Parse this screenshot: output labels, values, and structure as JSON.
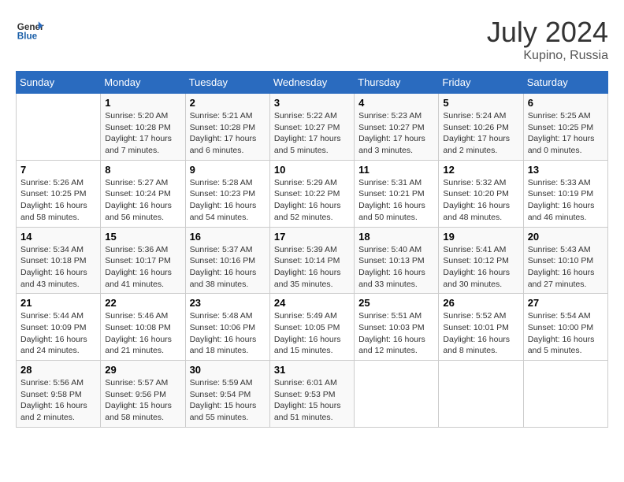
{
  "header": {
    "logo_line1": "General",
    "logo_line2": "Blue",
    "month_year": "July 2024",
    "location": "Kupino, Russia"
  },
  "weekdays": [
    "Sunday",
    "Monday",
    "Tuesday",
    "Wednesday",
    "Thursday",
    "Friday",
    "Saturday"
  ],
  "weeks": [
    [
      {
        "day": "",
        "info": ""
      },
      {
        "day": "1",
        "info": "Sunrise: 5:20 AM\nSunset: 10:28 PM\nDaylight: 17 hours\nand 7 minutes."
      },
      {
        "day": "2",
        "info": "Sunrise: 5:21 AM\nSunset: 10:28 PM\nDaylight: 17 hours\nand 6 minutes."
      },
      {
        "day": "3",
        "info": "Sunrise: 5:22 AM\nSunset: 10:27 PM\nDaylight: 17 hours\nand 5 minutes."
      },
      {
        "day": "4",
        "info": "Sunrise: 5:23 AM\nSunset: 10:27 PM\nDaylight: 17 hours\nand 3 minutes."
      },
      {
        "day": "5",
        "info": "Sunrise: 5:24 AM\nSunset: 10:26 PM\nDaylight: 17 hours\nand 2 minutes."
      },
      {
        "day": "6",
        "info": "Sunrise: 5:25 AM\nSunset: 10:25 PM\nDaylight: 17 hours\nand 0 minutes."
      }
    ],
    [
      {
        "day": "7",
        "info": "Sunrise: 5:26 AM\nSunset: 10:25 PM\nDaylight: 16 hours\nand 58 minutes."
      },
      {
        "day": "8",
        "info": "Sunrise: 5:27 AM\nSunset: 10:24 PM\nDaylight: 16 hours\nand 56 minutes."
      },
      {
        "day": "9",
        "info": "Sunrise: 5:28 AM\nSunset: 10:23 PM\nDaylight: 16 hours\nand 54 minutes."
      },
      {
        "day": "10",
        "info": "Sunrise: 5:29 AM\nSunset: 10:22 PM\nDaylight: 16 hours\nand 52 minutes."
      },
      {
        "day": "11",
        "info": "Sunrise: 5:31 AM\nSunset: 10:21 PM\nDaylight: 16 hours\nand 50 minutes."
      },
      {
        "day": "12",
        "info": "Sunrise: 5:32 AM\nSunset: 10:20 PM\nDaylight: 16 hours\nand 48 minutes."
      },
      {
        "day": "13",
        "info": "Sunrise: 5:33 AM\nSunset: 10:19 PM\nDaylight: 16 hours\nand 46 minutes."
      }
    ],
    [
      {
        "day": "14",
        "info": "Sunrise: 5:34 AM\nSunset: 10:18 PM\nDaylight: 16 hours\nand 43 minutes."
      },
      {
        "day": "15",
        "info": "Sunrise: 5:36 AM\nSunset: 10:17 PM\nDaylight: 16 hours\nand 41 minutes."
      },
      {
        "day": "16",
        "info": "Sunrise: 5:37 AM\nSunset: 10:16 PM\nDaylight: 16 hours\nand 38 minutes."
      },
      {
        "day": "17",
        "info": "Sunrise: 5:39 AM\nSunset: 10:14 PM\nDaylight: 16 hours\nand 35 minutes."
      },
      {
        "day": "18",
        "info": "Sunrise: 5:40 AM\nSunset: 10:13 PM\nDaylight: 16 hours\nand 33 minutes."
      },
      {
        "day": "19",
        "info": "Sunrise: 5:41 AM\nSunset: 10:12 PM\nDaylight: 16 hours\nand 30 minutes."
      },
      {
        "day": "20",
        "info": "Sunrise: 5:43 AM\nSunset: 10:10 PM\nDaylight: 16 hours\nand 27 minutes."
      }
    ],
    [
      {
        "day": "21",
        "info": "Sunrise: 5:44 AM\nSunset: 10:09 PM\nDaylight: 16 hours\nand 24 minutes."
      },
      {
        "day": "22",
        "info": "Sunrise: 5:46 AM\nSunset: 10:08 PM\nDaylight: 16 hours\nand 21 minutes."
      },
      {
        "day": "23",
        "info": "Sunrise: 5:48 AM\nSunset: 10:06 PM\nDaylight: 16 hours\nand 18 minutes."
      },
      {
        "day": "24",
        "info": "Sunrise: 5:49 AM\nSunset: 10:05 PM\nDaylight: 16 hours\nand 15 minutes."
      },
      {
        "day": "25",
        "info": "Sunrise: 5:51 AM\nSunset: 10:03 PM\nDaylight: 16 hours\nand 12 minutes."
      },
      {
        "day": "26",
        "info": "Sunrise: 5:52 AM\nSunset: 10:01 PM\nDaylight: 16 hours\nand 8 minutes."
      },
      {
        "day": "27",
        "info": "Sunrise: 5:54 AM\nSunset: 10:00 PM\nDaylight: 16 hours\nand 5 minutes."
      }
    ],
    [
      {
        "day": "28",
        "info": "Sunrise: 5:56 AM\nSunset: 9:58 PM\nDaylight: 16 hours\nand 2 minutes."
      },
      {
        "day": "29",
        "info": "Sunrise: 5:57 AM\nSunset: 9:56 PM\nDaylight: 15 hours\nand 58 minutes."
      },
      {
        "day": "30",
        "info": "Sunrise: 5:59 AM\nSunset: 9:54 PM\nDaylight: 15 hours\nand 55 minutes."
      },
      {
        "day": "31",
        "info": "Sunrise: 6:01 AM\nSunset: 9:53 PM\nDaylight: 15 hours\nand 51 minutes."
      },
      {
        "day": "",
        "info": ""
      },
      {
        "day": "",
        "info": ""
      },
      {
        "day": "",
        "info": ""
      }
    ]
  ]
}
